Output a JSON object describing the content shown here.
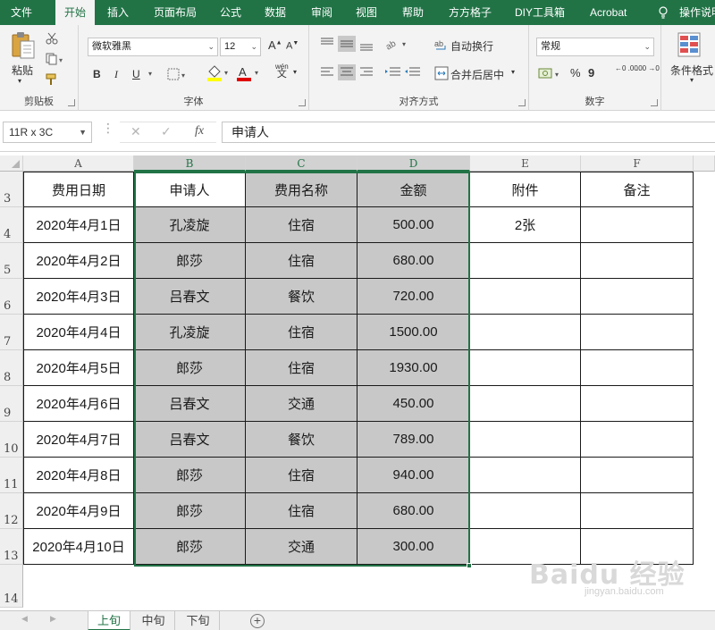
{
  "menu": {
    "tabs": [
      "文件",
      "开始",
      "插入",
      "页面布局",
      "公式",
      "数据",
      "审阅",
      "视图",
      "帮助",
      "方方格子",
      "DIY工具箱",
      "Acrobat",
      "操作说明"
    ],
    "active_index": 1
  },
  "ribbon": {
    "clipboard": {
      "paste_label": "粘贴",
      "group_label": "剪贴板"
    },
    "font": {
      "font_name": "微软雅黑",
      "font_size": "12",
      "grow_label": "A",
      "shrink_label": "A",
      "bold": "B",
      "italic": "I",
      "underline": "U",
      "phonetic_top": "wén",
      "phonetic_bottom": "文",
      "group_label": "字体"
    },
    "alignment": {
      "wrap_text": "自动换行",
      "merge_center": "合并后居中",
      "group_label": "对齐方式"
    },
    "number": {
      "format": "常规",
      "percent": "%",
      "comma": "9",
      "dec_inc": "←0 .00",
      "dec_dec": ".00 →0",
      "group_label": "数字"
    },
    "styles": {
      "conditional_format": "条件格式"
    }
  },
  "formula_bar": {
    "name_box": "11R x 3C",
    "fx": "fx",
    "content": "申请人"
  },
  "grid": {
    "columns": [
      "A",
      "B",
      "C",
      "D",
      "E",
      "F"
    ],
    "rows": [
      "3",
      "4",
      "5",
      "6",
      "7",
      "8",
      "9",
      "10",
      "11",
      "12",
      "13",
      "14"
    ],
    "header_row": [
      "费用日期",
      "申请人",
      "费用名称",
      "金额",
      "附件",
      "备注"
    ],
    "data_rows": [
      [
        "2020年4月1日",
        "孔凌旋",
        "住宿",
        "500.00",
        "2张",
        ""
      ],
      [
        "2020年4月2日",
        "郎莎",
        "住宿",
        "680.00",
        "",
        ""
      ],
      [
        "2020年4月3日",
        "吕春文",
        "餐饮",
        "720.00",
        "",
        ""
      ],
      [
        "2020年4月4日",
        "孔凌旋",
        "住宿",
        "1500.00",
        "",
        ""
      ],
      [
        "2020年4月5日",
        "郎莎",
        "住宿",
        "1930.00",
        "",
        ""
      ],
      [
        "2020年4月6日",
        "吕春文",
        "交通",
        "450.00",
        "",
        ""
      ],
      [
        "2020年4月7日",
        "吕春文",
        "餐饮",
        "789.00",
        "",
        ""
      ],
      [
        "2020年4月8日",
        "郎莎",
        "住宿",
        "940.00",
        "",
        ""
      ],
      [
        "2020年4月9日",
        "郎莎",
        "住宿",
        "680.00",
        "",
        ""
      ],
      [
        "2020年4月10日",
        "郎莎",
        "交通",
        "300.00",
        "",
        ""
      ]
    ],
    "selected_columns": [
      "B",
      "C",
      "D"
    ],
    "selection_fill": "#c8c8c8",
    "accent_color": "#217346"
  },
  "sheets": {
    "tabs": [
      "上旬",
      "中旬",
      "下旬"
    ],
    "active_index": 0,
    "add_label": "+"
  },
  "watermark": {
    "text": "Baidu 经验",
    "url": "jingyan.baidu.com"
  }
}
